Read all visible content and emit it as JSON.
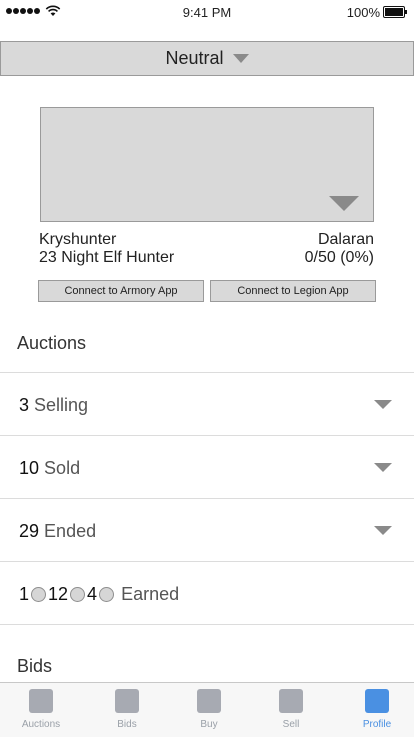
{
  "status_bar": {
    "time": "9:41 PM",
    "battery": "100%"
  },
  "faction": {
    "label": "Neutral"
  },
  "character": {
    "name": "Kryshunter",
    "description": "23 Night Elf Hunter",
    "realm": "Dalaran",
    "progress": "0/50 (0%)"
  },
  "buttons": {
    "armory": "Connect to Armory App",
    "legion": "Connect to Legion App"
  },
  "auctions": {
    "title": "Auctions",
    "selling": {
      "count": "3",
      "label": "Selling"
    },
    "sold": {
      "count": "10",
      "label": "Sold"
    },
    "ended": {
      "count": "29",
      "label": "Ended"
    },
    "earned": {
      "gold": "1",
      "silver": "12",
      "copper": "4",
      "label": "Earned"
    }
  },
  "bids": {
    "title": "Bids"
  },
  "tabs": [
    {
      "label": "Auctions"
    },
    {
      "label": "Bids"
    },
    {
      "label": "Buy"
    },
    {
      "label": "Sell"
    },
    {
      "label": "Profile"
    }
  ],
  "colors": {
    "accent": "#4a90e2",
    "inactive_tab": "#a7aab2",
    "panel": "#d9d9d9"
  }
}
